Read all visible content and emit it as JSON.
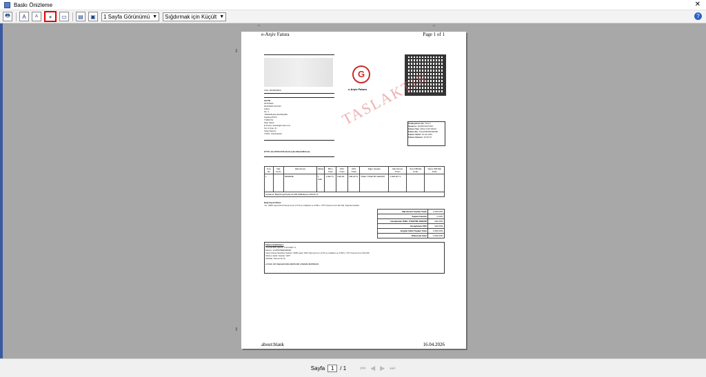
{
  "window": {
    "title": "Baskı Önizleme",
    "close_glyph": "✕"
  },
  "toolbar": {
    "buttons": [
      {
        "name": "print-icon",
        "glyph": "🖶"
      },
      {
        "name": "font-large-icon",
        "glyph": "A"
      },
      {
        "name": "font-small-icon",
        "glyph": "A"
      },
      {
        "name": "color-icon",
        "glyph": "●"
      },
      {
        "name": "page-setup-icon",
        "glyph": "▭"
      },
      {
        "name": "header-footer-icon",
        "glyph": "▤"
      },
      {
        "name": "fullscreen-icon",
        "glyph": "▣"
      }
    ],
    "view_select": "1 Sayfa Görünümü",
    "fit_select": "Sığdırmak için Küçült",
    "help_glyph": "?"
  },
  "page": {
    "header_left": "e-Arşiv Fatura",
    "header_right": "Page 1 of 1",
    "footer_left": "about:blank",
    "footer_right": "16.04.2026",
    "watermark": "TASLAKTIR",
    "logo_caption": "e-Arşiv Fatura",
    "invoice": {
      "vkn": "VKN: 5000000000",
      "sayin": "SAYIN",
      "musteri_lines": [
        "MUSTERI",
        "MUSTERI SOYAD",
        "Adres:",
        "No: 1",
        "YENIMAHALLE/ANKARA",
        "Kadıköy/İSTN.",
        "TÜRKİYE",
        "Web Sitesi:",
        "E-Posta: destek@ornek.com",
        "Tel: 0 (Fax: 0)",
        "Vergi Dairesi:",
        "TCKN: 11111111111"
      ],
      "info_rows": [
        [
          "Özelleştirme No:",
          "TR1.2"
        ],
        [
          "Senaryo:",
          "EARSIVFATURA"
        ],
        [
          "Fatura Tipi:",
          "ARAÇ FATURASI"
        ],
        [
          "Fatura No:",
          "SAL2026000000000"
        ],
        [
          "Fatura Tarihi:",
          "16.04.2026"
        ],
        [
          "Fatura Zamanı:",
          "15:39:07"
        ]
      ],
      "ettn": "ETTN: abcd7f33-0f49-4ba5-ae9e-8bba3d63ccae",
      "table_headers": [
        "Sıra No",
        "Mal Kodu",
        "Mal Hizmet",
        "Miktar",
        "Birim Fiyat",
        "KDV Oranı",
        "KDV Tutarı",
        "Diğer Vergiler",
        "Mal Hizmet Tutarı",
        "Sıra ÖIB Mal Kodu",
        "Satıcı ÖIB Mal Kodu"
      ],
      "table_row": [
        "1",
        "",
        "DENEME",
        "1 Adet",
        "1.000 TL",
        "%20,00",
        "200,00 TL",
        "ÖZEL TÜKETİM VERGİSİ",
        "1.000,00 TL",
        "",
        ""
      ],
      "table_note": "Açıklama: Bilgi/Vergi/Toplam/1.000,00/Bakiye/1.000,00 TL",
      "note_title": "Bilgi Kaydı Metni:",
      "note_text": "Yer: 3065 sayılı KDV Kanunu'nun (17/4-s) maddesi ve 4760 s. ÖTV Kanunu'nun 8/2 Md. Kapsamındadır.",
      "totals": [
        [
          "Mal Hizmet Toplam Tutarı",
          "1.000,00TL"
        ],
        [
          "Toplam İskonto",
          "0,00TL"
        ],
        [
          "Hesaplanan ÖZEL TÜKETİM VERGİSİ",
          "200,00TL"
        ],
        [
          "Hesaplanan KDV",
          "640,00TL"
        ],
        [
          "Vergiler Dahil Toplam Tutar",
          "1.840,00TL"
        ],
        [
          "Ödenecek Tutar",
          "1.840,00TL"
        ]
      ],
      "fatura_aciklama_title": "Fatura Açıklaması:",
      "fatura_aciklama_lines": [
        "YALNIZ BİN SEKİZ YÜZ KIRK TL",
        "Mersis: 1234567890000000",
        "Vergi İstisna Muafiyet Sebebi: 3065 sayılı KDV Kanunu'nun (17/4-s) maddesi ve 4760 s. ÖTV Kanunu'nun 8/2 Md.",
        "Ödeme Şekli: Havale / EFT",
        "Tahsilat: Fatura No ile"
      ],
      "footer_note": "e-Arşiv izni kapsamında elektronik ortamda iletilmiştir."
    }
  },
  "statusbar": {
    "page_label": "Sayfa",
    "page_value": "1",
    "page_total": "/ 1"
  }
}
